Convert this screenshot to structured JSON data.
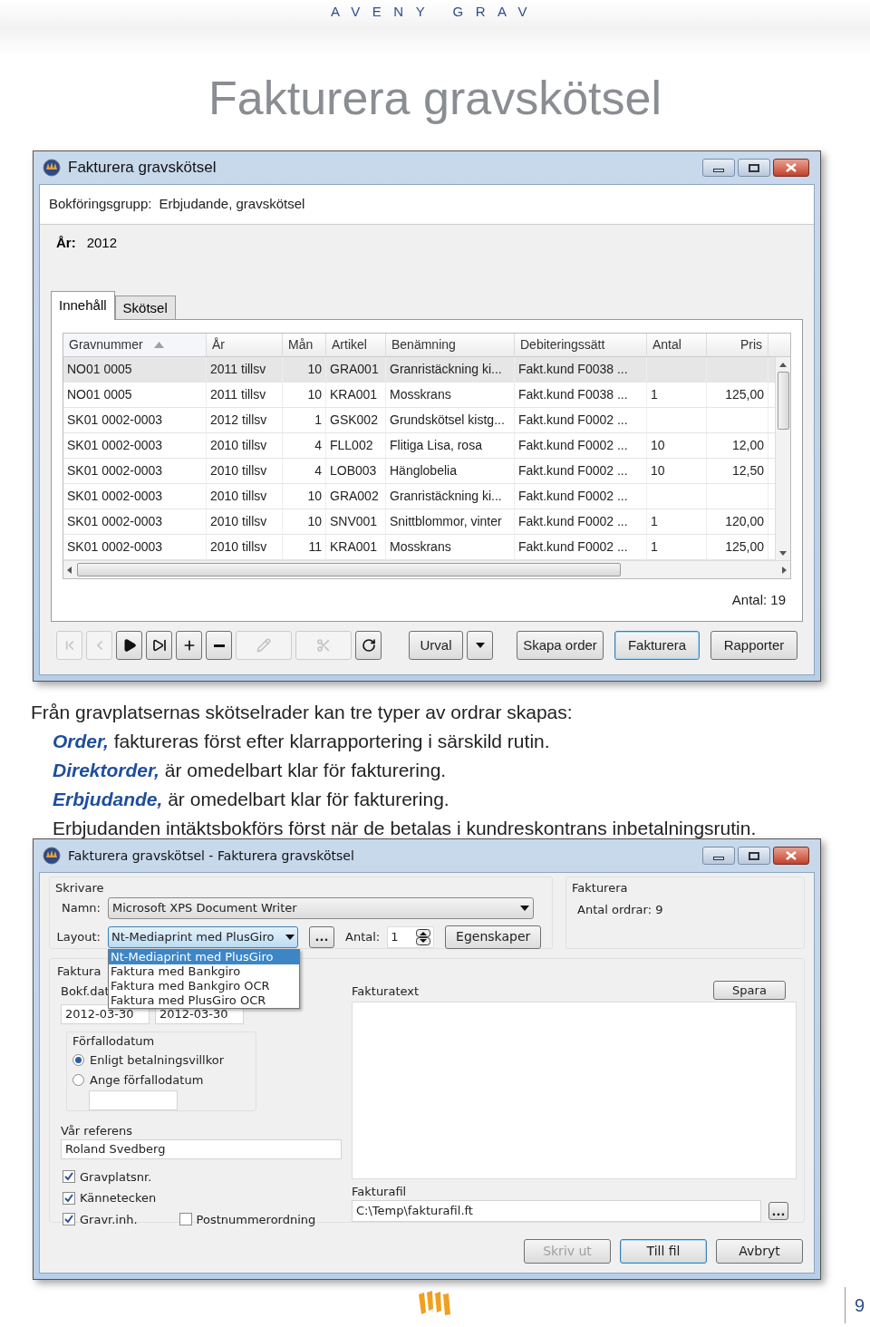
{
  "header": {
    "brand": "AVENY GRAV"
  },
  "page_title": "Fakturera gravskötsel",
  "window1": {
    "title": "Fakturera gravskötsel",
    "posting_group_label": "Bokföringsgrupp:",
    "posting_group": "Erbjudande, gravskötsel",
    "year_label": "År:",
    "year": "2012",
    "tabs": [
      {
        "label": "Innehåll",
        "selected": true
      },
      {
        "label": "Skötsel",
        "selected": false
      }
    ],
    "table": {
      "columns": [
        {
          "label": "Gravnummer",
          "sorted": true
        },
        {
          "label": "År",
          "sorted": false
        },
        {
          "label": "Mån",
          "sorted": false
        },
        {
          "label": "Artikel",
          "sorted": false
        },
        {
          "label": "Benämning",
          "sorted": false
        },
        {
          "label": "Debiteringssätt",
          "sorted": false
        },
        {
          "label": "Antal",
          "sorted": false
        },
        {
          "label": "Pris",
          "sorted": false
        }
      ],
      "rows": [
        {
          "selected": true,
          "cells": [
            "NO01 0005",
            "2011 tillsv",
            "10",
            "GRA001",
            "Granristäckning ki...",
            "Fakt.kund F0038 ...",
            "",
            ""
          ]
        },
        {
          "selected": false,
          "cells": [
            "NO01 0005",
            "2011 tillsv",
            "10",
            "KRA001",
            "Mosskrans",
            "Fakt.kund F0038 ...",
            "1",
            "125,00"
          ]
        },
        {
          "selected": false,
          "cells": [
            "SK01 0002-0003",
            "2012 tillsv",
            "1",
            "GSK002",
            "Grundskötsel kistg...",
            "Fakt.kund F0002 ...",
            "",
            ""
          ]
        },
        {
          "selected": false,
          "cells": [
            "SK01 0002-0003",
            "2010 tillsv",
            "4",
            "FLL002",
            "Flitiga Lisa, rosa",
            "Fakt.kund F0002 ...",
            "10",
            "12,00"
          ]
        },
        {
          "selected": false,
          "cells": [
            "SK01 0002-0003",
            "2010 tillsv",
            "4",
            "LOB003",
            "Hänglobelia",
            "Fakt.kund F0002 ...",
            "10",
            "12,50"
          ]
        },
        {
          "selected": false,
          "cells": [
            "SK01 0002-0003",
            "2010 tillsv",
            "10",
            "GRA002",
            "Granristäckning ki...",
            "Fakt.kund F0002 ...",
            "",
            ""
          ]
        },
        {
          "selected": false,
          "cells": [
            "SK01 0002-0003",
            "2010 tillsv",
            "10",
            "SNV001",
            "Snittblommor, vinter",
            "Fakt.kund F0002 ...",
            "1",
            "120,00"
          ]
        },
        {
          "selected": false,
          "cells": [
            "SK01 0002-0003",
            "2010 tillsv",
            "11",
            "KRA001",
            "Mosskrans",
            "Fakt.kund F0002 ...",
            "1",
            "125,00"
          ]
        }
      ]
    },
    "count": "Antal: 19",
    "toolbar": [
      {
        "kind": "first",
        "disabled": true
      },
      {
        "kind": "previous",
        "disabled": true
      },
      {
        "kind": "next",
        "disabled": false
      },
      {
        "kind": "last",
        "disabled": false
      },
      {
        "kind": "add",
        "disabled": false
      },
      {
        "kind": "remove",
        "disabled": false
      },
      {
        "kind": "edit",
        "disabled": true
      },
      {
        "kind": "cut",
        "disabled": true
      },
      {
        "kind": "refresh",
        "disabled": false
      }
    ],
    "urval": "Urval",
    "buttons": [
      {
        "label": "Skapa order",
        "default": false
      },
      {
        "label": "Fakturera",
        "default": true
      },
      {
        "label": "Rapporter",
        "default": false
      }
    ]
  },
  "description": {
    "intro": "Från gravplatsernas skötselrader kan tre typer av ordrar skapas:",
    "items": [
      {
        "term": "Order,",
        "text": " faktureras först efter klarrapportering i särskild rutin."
      },
      {
        "term": "Direktorder,",
        "text": " är omedelbart klar för fakturering."
      },
      {
        "term": "Erbjudande,",
        "text": " är omedelbart klar för fakturering."
      }
    ],
    "note": "Erbjudanden intäktsbokförs först när de betalas i kundreskontrans inbetalningsrutin."
  },
  "window2": {
    "title": "Fakturera gravskötsel - Fakturera gravskötsel",
    "printer_legend": "Skrivare",
    "name_label": "Namn:",
    "printer": "Microsoft XPS Document Writer",
    "layout_label": "Layout:",
    "layout": "Nt-Mediaprint med PlusGiro",
    "layout_expanded": true,
    "layout_options": [
      {
        "label": "Nt-Mediaprint med PlusGiro",
        "selected": true
      },
      {
        "label": "Faktura med Bankgiro",
        "selected": false
      },
      {
        "label": "Faktura med Bankgiro OCR",
        "selected": false
      },
      {
        "label": "Faktura med PlusGiro OCR",
        "selected": false
      }
    ],
    "ellipsis": "...",
    "copies_label": "Antal:",
    "copies": "1",
    "properties": "Egenskaper",
    "invoice_legend": "Fakturera",
    "orders": "Antal ordrar: 9",
    "faktura_legend": "Faktura",
    "posting_date_label": "Bokf.dat",
    "dates": [
      "2012-03-30",
      "2012-03-30"
    ],
    "due_legend": "Förfallodatum",
    "due_options": [
      {
        "label": "Enligt betalningsvillkor",
        "selected": true
      },
      {
        "label": "Ange förfallodatum",
        "selected": false
      }
    ],
    "reference_label": "Vår referens",
    "reference": "Roland Svedberg",
    "checkboxes": [
      {
        "label": "Gravplatsnr.",
        "checked": true
      },
      {
        "label": "Kännetecken",
        "checked": true
      },
      {
        "label": "Gravr.inh.",
        "checked": true
      },
      {
        "label": "Postnummerordning",
        "checked": false
      }
    ],
    "text_label": "Fakturatext",
    "save": "Spara",
    "file_label": "Fakturafil",
    "file": "C:\\Temp\\fakturafil.ft",
    "file_button": "...",
    "buttons": [
      {
        "label": "Skriv ut",
        "disabled": true,
        "default": false
      },
      {
        "label": "Till fil",
        "disabled": false,
        "default": true
      },
      {
        "label": "Avbryt",
        "disabled": false,
        "default": false
      }
    ]
  },
  "footer": {
    "page_number": "9"
  }
}
